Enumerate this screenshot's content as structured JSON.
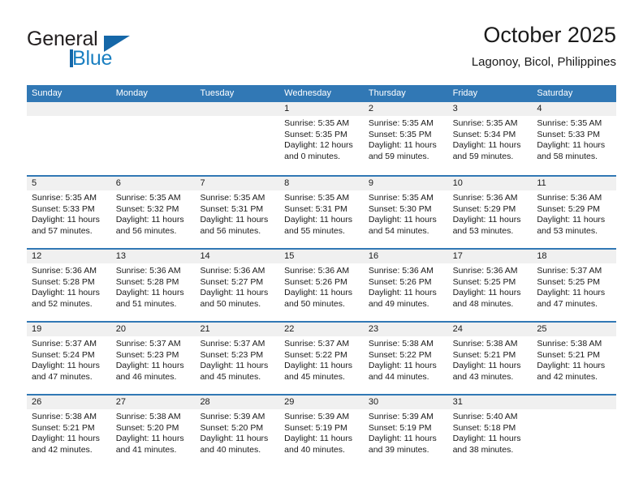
{
  "brand": {
    "name_top": "General",
    "name_bottom": "Blue",
    "logo_icon": "triangle-logo-icon",
    "accent_color": "#1567a8"
  },
  "header": {
    "title": "October 2025",
    "subtitle": "Lagonoy, Bicol, Philippines"
  },
  "calendar": {
    "header_color": "#3178b5",
    "weekdays": [
      "Sunday",
      "Monday",
      "Tuesday",
      "Wednesday",
      "Thursday",
      "Friday",
      "Saturday"
    ],
    "weeks": [
      [
        {
          "date": "",
          "empty": true
        },
        {
          "date": "",
          "empty": true
        },
        {
          "date": "",
          "empty": true
        },
        {
          "date": "1",
          "sunrise": "Sunrise: 5:35 AM",
          "sunset": "Sunset: 5:35 PM",
          "daylight": "Daylight: 12 hours and 0 minutes."
        },
        {
          "date": "2",
          "sunrise": "Sunrise: 5:35 AM",
          "sunset": "Sunset: 5:35 PM",
          "daylight": "Daylight: 11 hours and 59 minutes."
        },
        {
          "date": "3",
          "sunrise": "Sunrise: 5:35 AM",
          "sunset": "Sunset: 5:34 PM",
          "daylight": "Daylight: 11 hours and 59 minutes."
        },
        {
          "date": "4",
          "sunrise": "Sunrise: 5:35 AM",
          "sunset": "Sunset: 5:33 PM",
          "daylight": "Daylight: 11 hours and 58 minutes."
        }
      ],
      [
        {
          "date": "5",
          "sunrise": "Sunrise: 5:35 AM",
          "sunset": "Sunset: 5:33 PM",
          "daylight": "Daylight: 11 hours and 57 minutes."
        },
        {
          "date": "6",
          "sunrise": "Sunrise: 5:35 AM",
          "sunset": "Sunset: 5:32 PM",
          "daylight": "Daylight: 11 hours and 56 minutes."
        },
        {
          "date": "7",
          "sunrise": "Sunrise: 5:35 AM",
          "sunset": "Sunset: 5:31 PM",
          "daylight": "Daylight: 11 hours and 56 minutes."
        },
        {
          "date": "8",
          "sunrise": "Sunrise: 5:35 AM",
          "sunset": "Sunset: 5:31 PM",
          "daylight": "Daylight: 11 hours and 55 minutes."
        },
        {
          "date": "9",
          "sunrise": "Sunrise: 5:35 AM",
          "sunset": "Sunset: 5:30 PM",
          "daylight": "Daylight: 11 hours and 54 minutes."
        },
        {
          "date": "10",
          "sunrise": "Sunrise: 5:36 AM",
          "sunset": "Sunset: 5:29 PM",
          "daylight": "Daylight: 11 hours and 53 minutes."
        },
        {
          "date": "11",
          "sunrise": "Sunrise: 5:36 AM",
          "sunset": "Sunset: 5:29 PM",
          "daylight": "Daylight: 11 hours and 53 minutes."
        }
      ],
      [
        {
          "date": "12",
          "sunrise": "Sunrise: 5:36 AM",
          "sunset": "Sunset: 5:28 PM",
          "daylight": "Daylight: 11 hours and 52 minutes."
        },
        {
          "date": "13",
          "sunrise": "Sunrise: 5:36 AM",
          "sunset": "Sunset: 5:28 PM",
          "daylight": "Daylight: 11 hours and 51 minutes."
        },
        {
          "date": "14",
          "sunrise": "Sunrise: 5:36 AM",
          "sunset": "Sunset: 5:27 PM",
          "daylight": "Daylight: 11 hours and 50 minutes."
        },
        {
          "date": "15",
          "sunrise": "Sunrise: 5:36 AM",
          "sunset": "Sunset: 5:26 PM",
          "daylight": "Daylight: 11 hours and 50 minutes."
        },
        {
          "date": "16",
          "sunrise": "Sunrise: 5:36 AM",
          "sunset": "Sunset: 5:26 PM",
          "daylight": "Daylight: 11 hours and 49 minutes."
        },
        {
          "date": "17",
          "sunrise": "Sunrise: 5:36 AM",
          "sunset": "Sunset: 5:25 PM",
          "daylight": "Daylight: 11 hours and 48 minutes."
        },
        {
          "date": "18",
          "sunrise": "Sunrise: 5:37 AM",
          "sunset": "Sunset: 5:25 PM",
          "daylight": "Daylight: 11 hours and 47 minutes."
        }
      ],
      [
        {
          "date": "19",
          "sunrise": "Sunrise: 5:37 AM",
          "sunset": "Sunset: 5:24 PM",
          "daylight": "Daylight: 11 hours and 47 minutes."
        },
        {
          "date": "20",
          "sunrise": "Sunrise: 5:37 AM",
          "sunset": "Sunset: 5:23 PM",
          "daylight": "Daylight: 11 hours and 46 minutes."
        },
        {
          "date": "21",
          "sunrise": "Sunrise: 5:37 AM",
          "sunset": "Sunset: 5:23 PM",
          "daylight": "Daylight: 11 hours and 45 minutes."
        },
        {
          "date": "22",
          "sunrise": "Sunrise: 5:37 AM",
          "sunset": "Sunset: 5:22 PM",
          "daylight": "Daylight: 11 hours and 45 minutes."
        },
        {
          "date": "23",
          "sunrise": "Sunrise: 5:38 AM",
          "sunset": "Sunset: 5:22 PM",
          "daylight": "Daylight: 11 hours and 44 minutes."
        },
        {
          "date": "24",
          "sunrise": "Sunrise: 5:38 AM",
          "sunset": "Sunset: 5:21 PM",
          "daylight": "Daylight: 11 hours and 43 minutes."
        },
        {
          "date": "25",
          "sunrise": "Sunrise: 5:38 AM",
          "sunset": "Sunset: 5:21 PM",
          "daylight": "Daylight: 11 hours and 42 minutes."
        }
      ],
      [
        {
          "date": "26",
          "sunrise": "Sunrise: 5:38 AM",
          "sunset": "Sunset: 5:21 PM",
          "daylight": "Daylight: 11 hours and 42 minutes."
        },
        {
          "date": "27",
          "sunrise": "Sunrise: 5:38 AM",
          "sunset": "Sunset: 5:20 PM",
          "daylight": "Daylight: 11 hours and 41 minutes."
        },
        {
          "date": "28",
          "sunrise": "Sunrise: 5:39 AM",
          "sunset": "Sunset: 5:20 PM",
          "daylight": "Daylight: 11 hours and 40 minutes."
        },
        {
          "date": "29",
          "sunrise": "Sunrise: 5:39 AM",
          "sunset": "Sunset: 5:19 PM",
          "daylight": "Daylight: 11 hours and 40 minutes."
        },
        {
          "date": "30",
          "sunrise": "Sunrise: 5:39 AM",
          "sunset": "Sunset: 5:19 PM",
          "daylight": "Daylight: 11 hours and 39 minutes."
        },
        {
          "date": "31",
          "sunrise": "Sunrise: 5:40 AM",
          "sunset": "Sunset: 5:18 PM",
          "daylight": "Daylight: 11 hours and 38 minutes."
        },
        {
          "date": "",
          "empty": true
        }
      ]
    ]
  }
}
